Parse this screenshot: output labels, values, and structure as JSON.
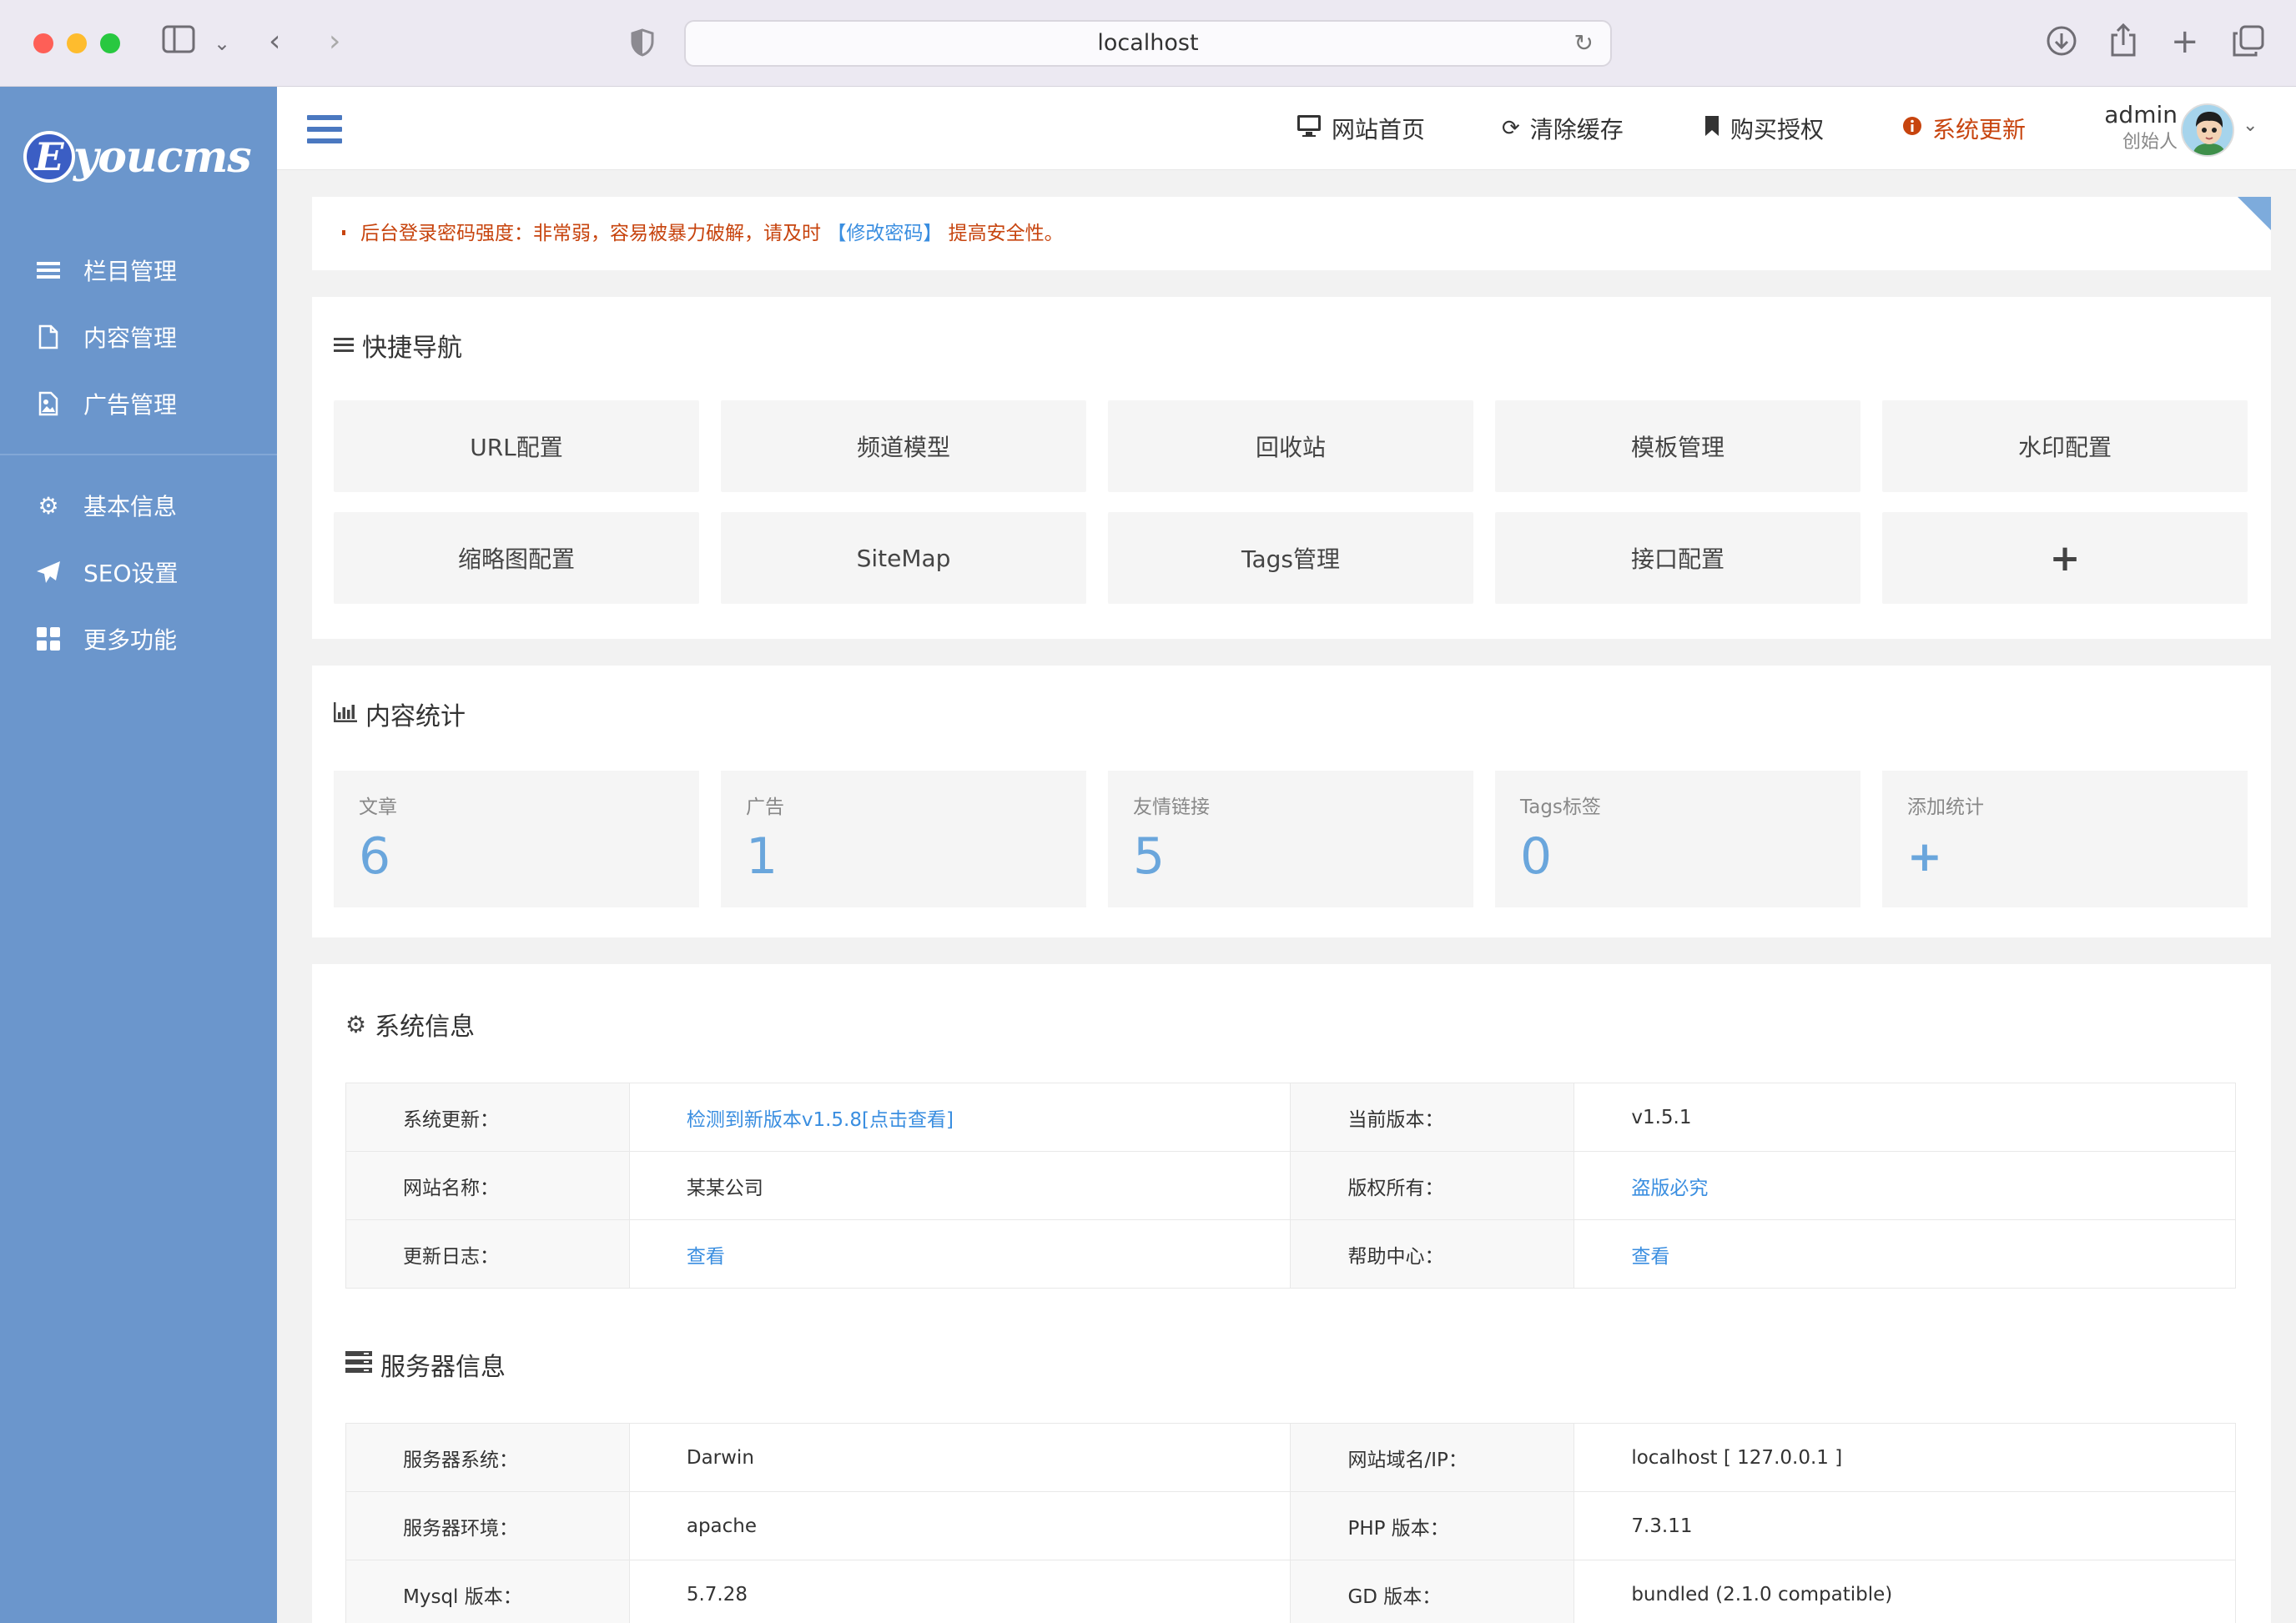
{
  "browser": {
    "url": "localhost"
  },
  "sidebar": {
    "logo": {
      "letter": "E",
      "text": "youcms"
    },
    "items": [
      {
        "label": "栏目管理",
        "icon": "list-icon"
      },
      {
        "label": "内容管理",
        "icon": "document-icon"
      },
      {
        "label": "广告管理",
        "icon": "image-icon"
      },
      {
        "label": "基本信息",
        "icon": "gear-icon"
      },
      {
        "label": "SEO设置",
        "icon": "paper-plane-icon"
      },
      {
        "label": "更多功能",
        "icon": "grid-icon"
      }
    ]
  },
  "header": {
    "links": [
      {
        "label": "网站首页",
        "icon": "monitor-icon"
      },
      {
        "label": "清除缓存",
        "icon": "refresh-icon"
      },
      {
        "label": "购买授权",
        "icon": "bookmark-icon"
      },
      {
        "label": "系统更新",
        "icon": "info-icon"
      }
    ],
    "user": {
      "name": "admin",
      "role": "创始人"
    }
  },
  "notice": {
    "prefix": "后台登录密码强度：非常弱，容易被暴力破解，请及时",
    "link": "【修改密码】",
    "suffix": "提高安全性。"
  },
  "quick_nav": {
    "title": "快捷导航",
    "items": [
      "URL配置",
      "频道模型",
      "回收站",
      "模板管理",
      "水印配置",
      "缩略图配置",
      "SiteMap",
      "Tags管理",
      "接口配置",
      "+"
    ]
  },
  "stats": {
    "title": "内容统计",
    "items": [
      {
        "label": "文章",
        "value": "6"
      },
      {
        "label": "广告",
        "value": "1"
      },
      {
        "label": "友情链接",
        "value": "5"
      },
      {
        "label": "Tags标签",
        "value": "0"
      },
      {
        "label": "添加统计",
        "value": "+"
      }
    ]
  },
  "system_info": {
    "title": "系统信息",
    "rows": [
      [
        "系统更新：",
        "检测到新版本v1.5.8[点击查看]",
        "当前版本：",
        "v1.5.1"
      ],
      [
        "网站名称：",
        "某某公司",
        "版权所有：",
        "盗版必究"
      ],
      [
        "更新日志：",
        "查看",
        "帮助中心：",
        "查看"
      ]
    ]
  },
  "server_info": {
    "title": "服务器信息",
    "rows": [
      [
        "服务器系统：",
        "Darwin",
        "网站域名/IP：",
        "localhost [ 127.0.0.1 ]"
      ],
      [
        "服务器环境：",
        "apache",
        "PHP 版本：",
        "7.3.11"
      ],
      [
        "Mysql 版本：",
        "5.7.28",
        "GD 版本：",
        "bundled (2.1.0 compatible)"
      ]
    ]
  },
  "colors": {
    "sidebar": "#6b96cc",
    "accent": "#6aa6dc",
    "alert": "#c7440e",
    "link": "#3a8ee0"
  }
}
